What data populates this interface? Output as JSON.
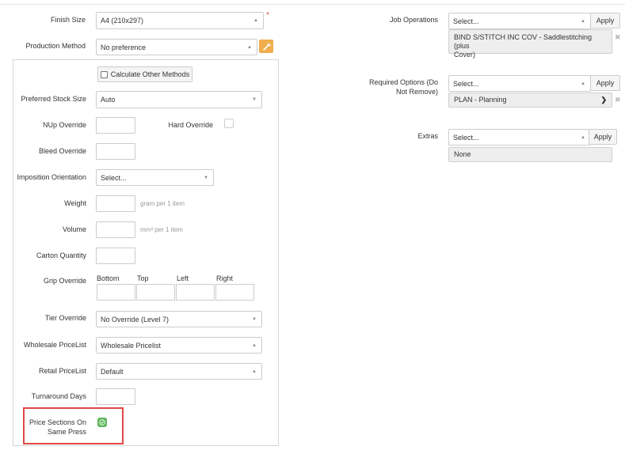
{
  "left": {
    "finish_size": {
      "label": "Finish Size",
      "value": "A4 (210x297)",
      "required": "*"
    },
    "production_method": {
      "label": "Production Method",
      "value": "No preference"
    },
    "calc_button": "Calculate Other Methods",
    "preferred_stock_size": {
      "label": "Preferred Stock Size",
      "value": "Auto"
    },
    "nup_override": {
      "label": "NUp Override"
    },
    "hard_override": {
      "label": "Hard Override"
    },
    "bleed_override": {
      "label": "Bleed Override"
    },
    "imposition_orientation": {
      "label": "Imposition Orientation",
      "value": "Select..."
    },
    "weight": {
      "label": "Weight",
      "hint": "gram per 1 item"
    },
    "volume": {
      "label": "Volume",
      "hint": "mm³ per 1 item"
    },
    "carton_quantity": {
      "label": "Carton Quantity"
    },
    "grip_override": {
      "label": "Grip Override",
      "cols": [
        "Bottom",
        "Top",
        "Left",
        "Right"
      ]
    },
    "tier_override": {
      "label": "Tier Override",
      "value": "No Override (Level 7)"
    },
    "wholesale_pricelist": {
      "label": "Wholesale PriceList",
      "value": "Wholesale Pricelist"
    },
    "retail_pricelist": {
      "label": "Retail PriceList",
      "value": "Default"
    },
    "turnaround_days": {
      "label": "Turnaround Days"
    },
    "price_sections": {
      "label_line1": "Price Sections On",
      "label_line2": "Same Press",
      "checked": true
    }
  },
  "right": {
    "job_operations": {
      "label": "Job Operations",
      "placeholder": "Select...",
      "apply": "Apply",
      "tag_line1": "BIND S/STITCH INC COV - Saddlestitching (plus",
      "tag_line2": "Cover)"
    },
    "required_options": {
      "label_line1": "Required Options (Do",
      "label_line2": "Not Remove)",
      "placeholder": "Select...",
      "apply": "Apply",
      "tag": "PLAN - Planning"
    },
    "extras": {
      "label": "Extras",
      "placeholder": "Select...",
      "apply": "Apply",
      "tag": "None"
    }
  },
  "colors": {
    "accent_orange": "#f0ad4e",
    "check_green": "#5cb85c",
    "highlight_red": "#e04848",
    "required_red": "#d9534f"
  }
}
